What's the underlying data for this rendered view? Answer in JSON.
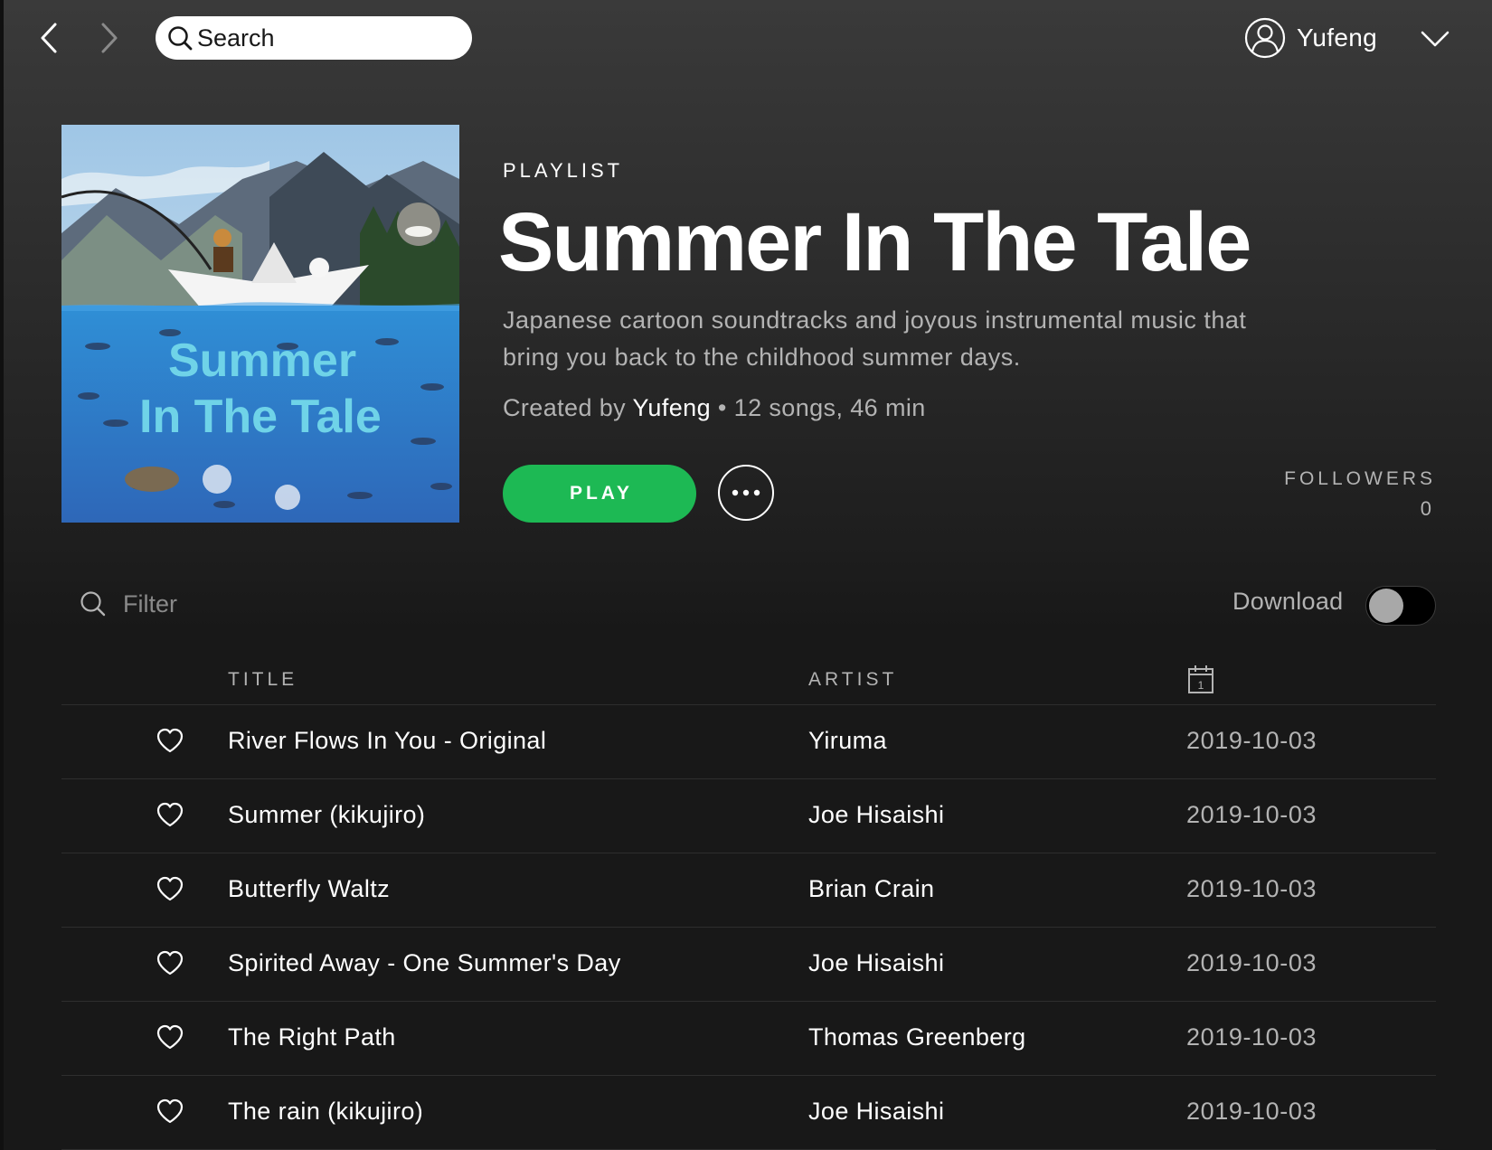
{
  "topbar": {
    "back_icon": "chevron-left-icon",
    "forward_icon": "chevron-right-icon",
    "search_placeholder": "Search",
    "user_name": "Yufeng",
    "user_icon": "user-circle-icon",
    "menu_icon": "chevron-down-icon"
  },
  "playlist": {
    "type_label": "PLAYLIST",
    "title": "Summer In The Tale",
    "description": "Japanese cartoon soundtracks and joyous instrumental music that bring you back to the childhood summer days.",
    "created_by_prefix": "Created by",
    "owner": "Yufeng",
    "stats": "• 12 songs, 46 min",
    "cover_text_line1": "Summer",
    "cover_text_line2": "In The Tale",
    "play_label": "PLAY",
    "more_icon": "more-options-icon",
    "followers_label": "FOLLOWERS",
    "followers_count": "0"
  },
  "filter": {
    "placeholder": "Filter",
    "icon": "search-icon"
  },
  "download": {
    "label": "Download",
    "enabled": false
  },
  "table": {
    "columns": {
      "title": "TITLE",
      "artist": "ARTIST",
      "date_icon": "calendar-icon",
      "date_icon_text": "1"
    },
    "tracks": [
      {
        "title": "River Flows In You - Original",
        "artist": "Yiruma",
        "added": "2019-10-03"
      },
      {
        "title": "Summer (kikujiro)",
        "artist": "Joe Hisaishi",
        "added": "2019-10-03"
      },
      {
        "title": "Butterfly Waltz",
        "artist": "Brian Crain",
        "added": "2019-10-03"
      },
      {
        "title": "Spirited Away - One Summer's Day",
        "artist": "Joe Hisaishi",
        "added": "2019-10-03"
      },
      {
        "title": "The Right Path",
        "artist": "Thomas Greenberg",
        "added": "2019-10-03"
      },
      {
        "title": "The rain (kikujiro)",
        "artist": "Joe Hisaishi",
        "added": "2019-10-03"
      }
    ]
  },
  "colors": {
    "accent_green": "#1db954",
    "background": "#181818",
    "text_muted": "#b3b3b3"
  }
}
